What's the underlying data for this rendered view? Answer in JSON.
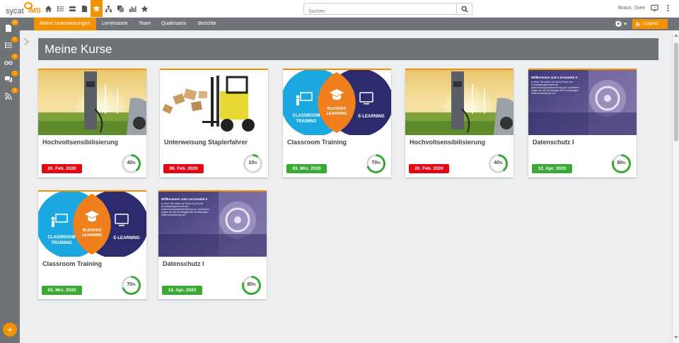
{
  "logo": {
    "part1": "sycat",
    "part2": "IMS"
  },
  "search": {
    "placeholder": "Suchen"
  },
  "user": {
    "name": "Braun, Sven"
  },
  "rail": {
    "badges": [
      "21",
      "7",
      "2",
      "1",
      "3"
    ]
  },
  "nav": {
    "tabs": [
      {
        "label": "Meine Unterweisungen",
        "active": true
      },
      {
        "label": "Lernhistorie"
      },
      {
        "label": "Team"
      },
      {
        "label": "Qualimatrix"
      },
      {
        "label": "Berichte"
      }
    ],
    "logout": "Logout"
  },
  "page": {
    "title": "Meine Kurse"
  },
  "colors": {
    "accent": "#f39200",
    "bar": "#6f7377",
    "overdue": "#e30613",
    "ok": "#3aaa35",
    "ring": "#3aaa35"
  },
  "thumbs": {
    "classroom": "CLASSROOM\nTRAINING",
    "blended": "BLENDED\nLEARNING",
    "elearning": "E-LEARNING",
    "ds_heading": "Willkommen zum Lernmodul A",
    "ds_body": "In einer Teil stellen wir Ihnen Zuvor und Grundsätzegebenheit der Datenschutzgrundverordnung vor. Außerdem zeigen wir die Grundlagen der rechtsetzigen Datenverarbeitung auf."
  },
  "courses": [
    {
      "title": "Hochvoltsensibilisierung",
      "date": "20. Feb. 2020",
      "status": "overdue",
      "progress": 40,
      "thumb": "charger"
    },
    {
      "title": "Unterweisung Staplerfahrer",
      "date": "08. Feb. 2020",
      "status": "overdue",
      "progress": 10,
      "thumb": "forklift"
    },
    {
      "title": "Classroom Training",
      "date": "03. Mrz. 2020",
      "status": "ok",
      "progress": 70,
      "thumb": "blended"
    },
    {
      "title": "Hochvoltsensibilisierung",
      "date": "20. Feb. 2020",
      "status": "overdue",
      "progress": 40,
      "thumb": "charger"
    },
    {
      "title": "Datenschutz I",
      "date": "12. Apr. 2020",
      "status": "ok",
      "progress": 80,
      "thumb": "vault"
    },
    {
      "title": "Classroom Training",
      "date": "03. Mrz. 2020",
      "status": "ok",
      "progress": 70,
      "thumb": "blended"
    },
    {
      "title": "Datenschutz I",
      "date": "12. Apr. 2020",
      "status": "ok",
      "progress": 80,
      "thumb": "vault"
    }
  ]
}
